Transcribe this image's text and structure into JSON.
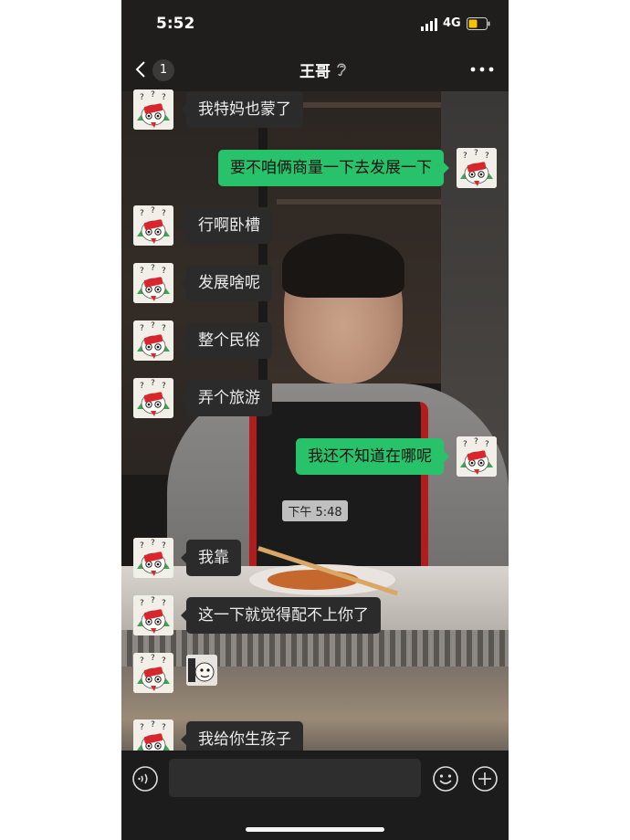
{
  "status_bar": {
    "time": "5:52",
    "network": "4G"
  },
  "nav": {
    "back_badge": "1",
    "title": "王哥"
  },
  "messages": [
    {
      "side": "in",
      "text": "我特妈也蒙了"
    },
    {
      "side": "out",
      "text": "要不咱俩商量一下去发展一下"
    },
    {
      "side": "in",
      "text": "行啊卧槽"
    },
    {
      "side": "in",
      "text": "发展啥呢"
    },
    {
      "side": "in",
      "text": "整个民俗"
    },
    {
      "side": "in",
      "text": "弄个旅游"
    },
    {
      "side": "out",
      "text": "我还不知道在哪呢"
    },
    {
      "side": "time",
      "text": "下午 5:48"
    },
    {
      "side": "in",
      "text": "我靠"
    },
    {
      "side": "in",
      "text": "这一下就觉得配不上你了"
    },
    {
      "side": "in",
      "type": "sticker"
    },
    {
      "side": "in",
      "text": "我给你生孩子"
    }
  ],
  "colors": {
    "outgoing_bubble": "#27c26a",
    "incoming_bubble": "#2b2b2b",
    "battery": "#f5c400"
  },
  "icons": [
    "chevron-left-icon",
    "ear-icon",
    "more-dots-icon",
    "signal-icon",
    "battery-icon",
    "voice-icon",
    "emoji-icon",
    "plus-icon"
  ]
}
